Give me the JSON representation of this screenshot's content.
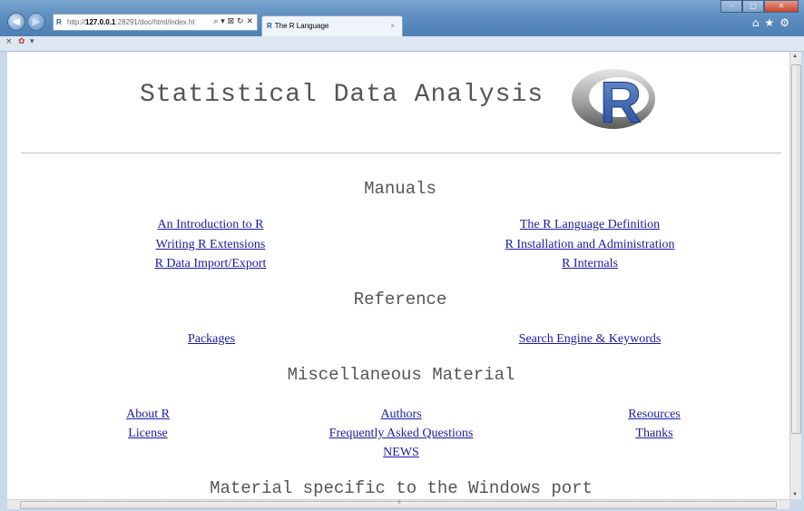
{
  "browser": {
    "address": {
      "prefix": "http://",
      "host": "127.0.0.1",
      "rest": ":28291/doc/html/index.ht"
    },
    "address_tools": "⌕ ▾ ⊠ ↻ ✕",
    "tab_title": "The R Language",
    "tab_close": "×",
    "favbar": {
      "close": "×",
      "item": "▾"
    }
  },
  "page": {
    "title": "Statistical Data Analysis",
    "logo_letter": "R",
    "sections": {
      "manuals": "Manuals",
      "reference": "Reference",
      "misc": "Miscellaneous Material",
      "windows": "Material specific to the Windows port"
    },
    "manuals": {
      "intro": "An Introduction to R",
      "extensions": "Writing R Extensions",
      "data_io": "R Data Import/Export",
      "lang_def": "The R Language Definition",
      "install_admin": "R Installation and Administration",
      "internals": "R Internals"
    },
    "reference": {
      "packages": "Packages",
      "search": "Search Engine & Keywords"
    },
    "misc": {
      "about": "About R",
      "license": "License",
      "authors": "Authors",
      "faq": "Frequently Asked Questions",
      "news": "NEWS",
      "resources": "Resources",
      "thanks": "Thanks"
    }
  },
  "colors": {
    "link": "#1a1aa6",
    "heading": "#555555",
    "chrome": "#5f8fc0"
  }
}
